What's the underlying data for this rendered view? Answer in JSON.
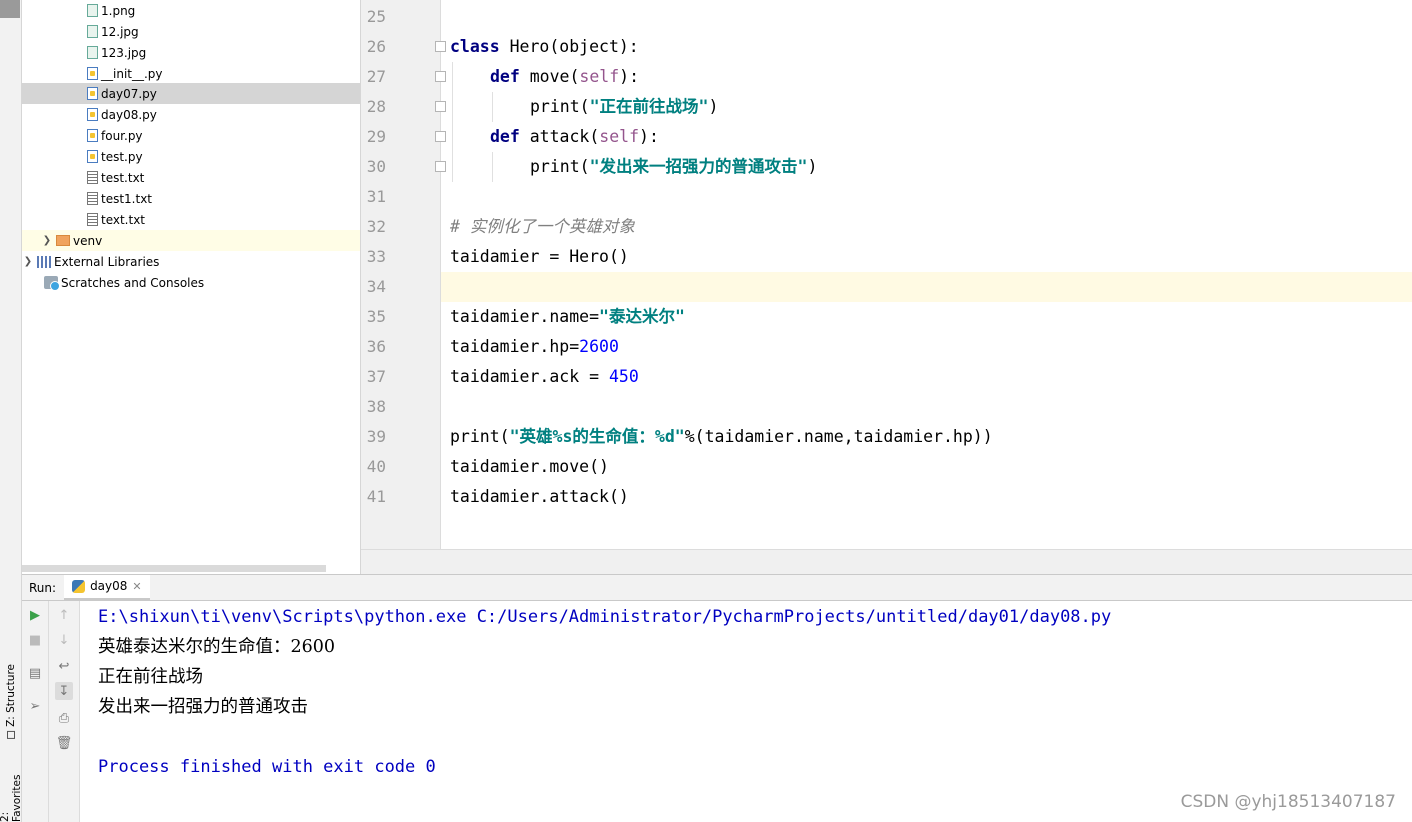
{
  "project_tree": {
    "items": [
      {
        "label": "1.png",
        "icon": "image-file-icon"
      },
      {
        "label": "12.jpg",
        "icon": "image-file-icon"
      },
      {
        "label": "123.jpg",
        "icon": "image-file-icon"
      },
      {
        "label": "__init__.py",
        "icon": "python-file-icon"
      },
      {
        "label": "day07.py",
        "icon": "python-file-icon"
      },
      {
        "label": "day08.py",
        "icon": "python-file-icon"
      },
      {
        "label": "four.py",
        "icon": "python-file-icon"
      },
      {
        "label": "test.py",
        "icon": "python-file-icon"
      },
      {
        "label": "test.txt",
        "icon": "text-file-icon"
      },
      {
        "label": "test1.txt",
        "icon": "text-file-icon"
      },
      {
        "label": "text.txt",
        "icon": "text-file-icon"
      },
      {
        "label": "venv",
        "icon": "folder-icon"
      },
      {
        "label": "External Libraries",
        "icon": "library-icon"
      },
      {
        "label": "Scratches and Consoles",
        "icon": "scratch-icon"
      }
    ],
    "selected": "day07.py"
  },
  "side_tabs": {
    "structure": "Z: Structure",
    "favorites": "2: Favorites"
  },
  "editor": {
    "line_numbers": [
      "25",
      "26",
      "27",
      "28",
      "29",
      "30",
      "31",
      "32",
      "33",
      "34",
      "35",
      "36",
      "37",
      "38",
      "39",
      "40",
      "41"
    ],
    "lines": {
      "l26": {
        "kw": "class",
        "rest": " Hero(object):"
      },
      "l27": {
        "kw": "def",
        "fn": " move(",
        "self": "self",
        "end": "):"
      },
      "l28": {
        "fn": "print(",
        "str": "\"正在前往战场\"",
        "end": ")"
      },
      "l29": {
        "kw": "def",
        "fn": " attack(",
        "self": "self",
        "end": "):"
      },
      "l30": {
        "fn": "print(",
        "str": "\"发出来一招强力的普通攻击\"",
        "end": ")"
      },
      "l32": {
        "comment": "# 实例化了一个英雄对象"
      },
      "l33": {
        "text": "taidamier = Hero()"
      },
      "l35": {
        "pre": "taidamier.name=",
        "str": "\"泰达米尔\""
      },
      "l36": {
        "pre": "taidamier.hp=",
        "num": "2600"
      },
      "l37": {
        "pre": "taidamier.ack = ",
        "num": "450"
      },
      "l39": {
        "pre": "print(",
        "str": "\"英雄%s的生命值：%d\"",
        "end": "%(taidamier.name,taidamier.hp))"
      },
      "l40": {
        "text": "taidamier.move()"
      },
      "l41": {
        "text": "taidamier.attack()"
      }
    },
    "current_line": "34"
  },
  "run_panel": {
    "label": "Run:",
    "tab": "day08",
    "console": {
      "command": "E:\\shixun\\ti\\venv\\Scripts\\python.exe C:/Users/Administrator/PycharmProjects/untitled/day01/day08.py",
      "outputs": [
        "英雄泰达米尔的生命值：2600",
        "正在前往战场",
        "发出来一招强力的普通攻击"
      ],
      "status": "Process finished with exit code 0"
    }
  },
  "watermark": "CSDN @yhj18513407187",
  "colors": {
    "keyword": "#000080",
    "string": "#008080",
    "number": "#0000ff",
    "self": "#94558d",
    "comment": "#808080",
    "console_path": "#0000c0",
    "current_line": "#fffae3"
  }
}
